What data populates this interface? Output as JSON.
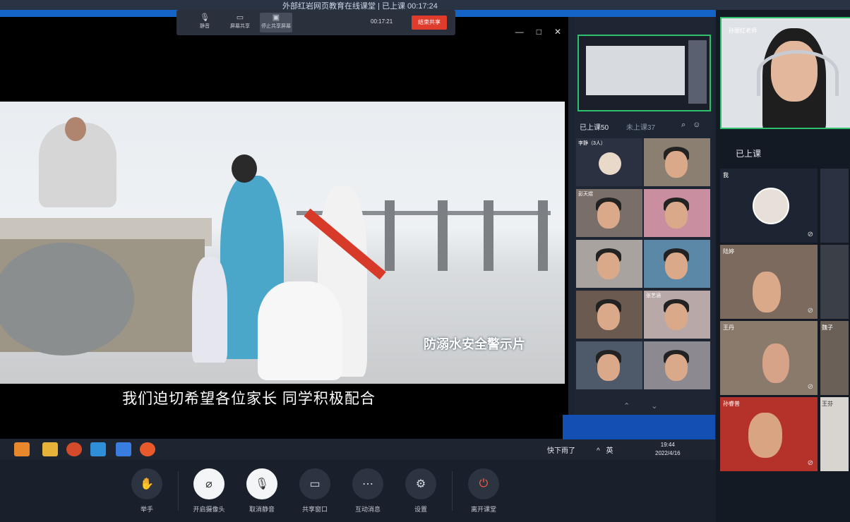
{
  "window": {
    "title": "外部红岩网页教育在线课堂 | 已上课 00:17:24"
  },
  "toolbar": {
    "mute_label": "静音",
    "share_label": "屏幕共享",
    "stop_share_label": "停止共享屏幕",
    "timer": "00:17:21",
    "end_label": "结束共享"
  },
  "shared_window": {
    "controls": [
      "—",
      "□",
      "✕"
    ],
    "subtitle": "我们迫切希望各位家长 同学积极配合",
    "watermark": "防溺水安全警示片"
  },
  "taskbar": {
    "weather": "快下雨了",
    "tray": "^ 英",
    "time": "19:44",
    "date": "2022/4/16"
  },
  "controls": [
    {
      "name": "raise-hand",
      "icon": "✋",
      "label": "举手"
    },
    {
      "name": "camera",
      "icon": "⌀",
      "label": "开启摄像头"
    },
    {
      "name": "mute",
      "icon": "🎙",
      "label": "取消静音"
    },
    {
      "name": "share",
      "icon": "▭",
      "label": "共享窗口"
    },
    {
      "name": "messages",
      "icon": "⋯",
      "label": "互动消息"
    },
    {
      "name": "settings",
      "icon": "⚙",
      "label": "设置"
    },
    {
      "name": "leave",
      "icon": "⏻",
      "label": "离开课堂"
    }
  ],
  "student_panel": {
    "tab_attended": "已上课50",
    "tab_absent": "未上课37",
    "students": [
      {
        "name": "李静（3人）"
      },
      {
        "name": ""
      },
      {
        "name": "彭天煜"
      },
      {
        "name": ""
      },
      {
        "name": ""
      },
      {
        "name": ""
      },
      {
        "name": ""
      },
      {
        "name": "张艺涵"
      },
      {
        "name": ""
      },
      {
        "name": ""
      }
    ]
  },
  "right_panel": {
    "teacher_name": "孙丽红老师",
    "section_label": "已上课",
    "cells": [
      {
        "name": "我"
      },
      {
        "name": "陆婷"
      },
      {
        "name": "王丹"
      },
      {
        "name": "孙睿普"
      }
    ],
    "side_cells": [
      {
        "name": ""
      },
      {
        "name": ""
      },
      {
        "name": "魏子"
      },
      {
        "name": "王芬"
      }
    ]
  }
}
